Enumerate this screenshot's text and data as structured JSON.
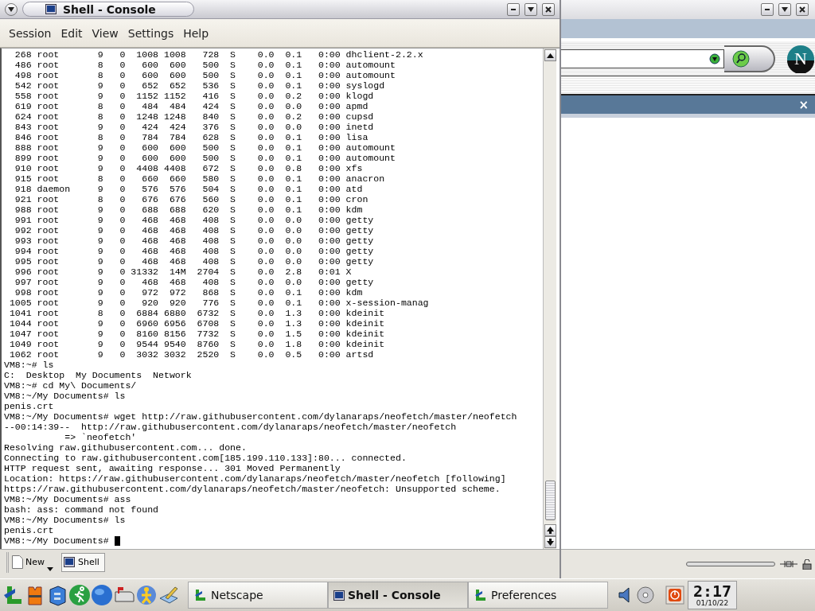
{
  "console_window": {
    "title": "Shell - Console",
    "menu": [
      "Session",
      "Edit",
      "View",
      "Settings",
      "Help"
    ],
    "terminal_lines": [
      "  268 root       9   0  1008 1008   728  S    0.0  0.1   0:00 dhclient-2.2.x",
      "  486 root       8   0   600  600   500  S    0.0  0.1   0:00 automount",
      "  498 root       8   0   600  600   500  S    0.0  0.1   0:00 automount",
      "  542 root       9   0   652  652   536  S    0.0  0.1   0:00 syslogd",
      "  558 root       9   0  1152 1152   416  S    0.0  0.2   0:00 klogd",
      "  619 root       8   0   484  484   424  S    0.0  0.0   0:00 apmd",
      "  624 root       8   0  1248 1248   840  S    0.0  0.2   0:00 cupsd",
      "  843 root       9   0   424  424   376  S    0.0  0.0   0:00 inetd",
      "  846 root       8   0   784  784   628  S    0.0  0.1   0:00 lisa",
      "  888 root       9   0   600  600   500  S    0.0  0.1   0:00 automount",
      "  899 root       9   0   600  600   500  S    0.0  0.1   0:00 automount",
      "  910 root       9   0  4408 4408   672  S    0.0  0.8   0:00 xfs",
      "  915 root       8   0   660  660   580  S    0.0  0.1   0:00 anacron",
      "  918 daemon     9   0   576  576   504  S    0.0  0.1   0:00 atd",
      "  921 root       8   0   676  676   560  S    0.0  0.1   0:00 cron",
      "  988 root       9   0   688  688   620  S    0.0  0.1   0:00 kdm",
      "  991 root       9   0   468  468   408  S    0.0  0.0   0:00 getty",
      "  992 root       9   0   468  468   408  S    0.0  0.0   0:00 getty",
      "  993 root       9   0   468  468   408  S    0.0  0.0   0:00 getty",
      "  994 root       9   0   468  468   408  S    0.0  0.0   0:00 getty",
      "  995 root       9   0   468  468   408  S    0.0  0.0   0:00 getty",
      "  996 root       9   0 31332  14M  2704  S    0.0  2.8   0:01 X",
      "  997 root       9   0   468  468   408  S    0.0  0.0   0:00 getty",
      "  998 root       9   0   972  972   868  S    0.0  0.1   0:00 kdm",
      " 1005 root       9   0   920  920   776  S    0.0  0.1   0:00 x-session-manag",
      " 1041 root       8   0  6884 6880  6732  S    0.0  1.3   0:00 kdeinit",
      " 1044 root       9   0  6960 6956  6708  S    0.0  1.3   0:00 kdeinit",
      " 1047 root       9   0  8160 8156  7732  S    0.0  1.5   0:00 kdeinit",
      " 1049 root       9   0  9544 9540  8760  S    0.0  1.8   0:00 kdeinit",
      " 1062 root       9   0  3032 3032  2520  S    0.0  0.5   0:00 artsd",
      "VM8:~# ls",
      "C:  Desktop  My Documents  Network",
      "VM8:~# cd My\\ Documents/",
      "VM8:~/My Documents# ls",
      "penis.crt",
      "VM8:~/My Documents# wget http://raw.githubusercontent.com/dylanaraps/neofetch/master/neofetch",
      "--00:14:39--  http://raw.githubusercontent.com/dylanaraps/neofetch/master/neofetch",
      "           => `neofetch'",
      "Resolving raw.githubusercontent.com... done.",
      "Connecting to raw.githubusercontent.com[185.199.110.133]:80... connected.",
      "HTTP request sent, awaiting response... 301 Moved Permanently",
      "Location: https://raw.githubusercontent.com/dylanaraps/neofetch/master/neofetch [following]",
      "https://raw.githubusercontent.com/dylanaraps/neofetch/master/neofetch: Unsupported scheme.",
      "VM8:~/My Documents# ass",
      "bash: ass: command not found",
      "VM8:~/My Documents# ls",
      "penis.crt"
    ],
    "prompt": "VM8:~/My Documents#",
    "new_button": "New",
    "tabs": [
      {
        "label": "Shell",
        "selected": true
      }
    ]
  },
  "browser_window": {
    "logo": "N",
    "sidebar_close": "×"
  },
  "taskbar": {
    "tasks": [
      {
        "label": "Netscape",
        "selected": false,
        "kind": "netscape"
      },
      {
        "label": "Shell - Console",
        "selected": true,
        "kind": "console"
      },
      {
        "label": "Preferences",
        "selected": false,
        "kind": "netscape"
      }
    ],
    "clock": {
      "time": "2:17",
      "date": "01/10/22"
    }
  }
}
